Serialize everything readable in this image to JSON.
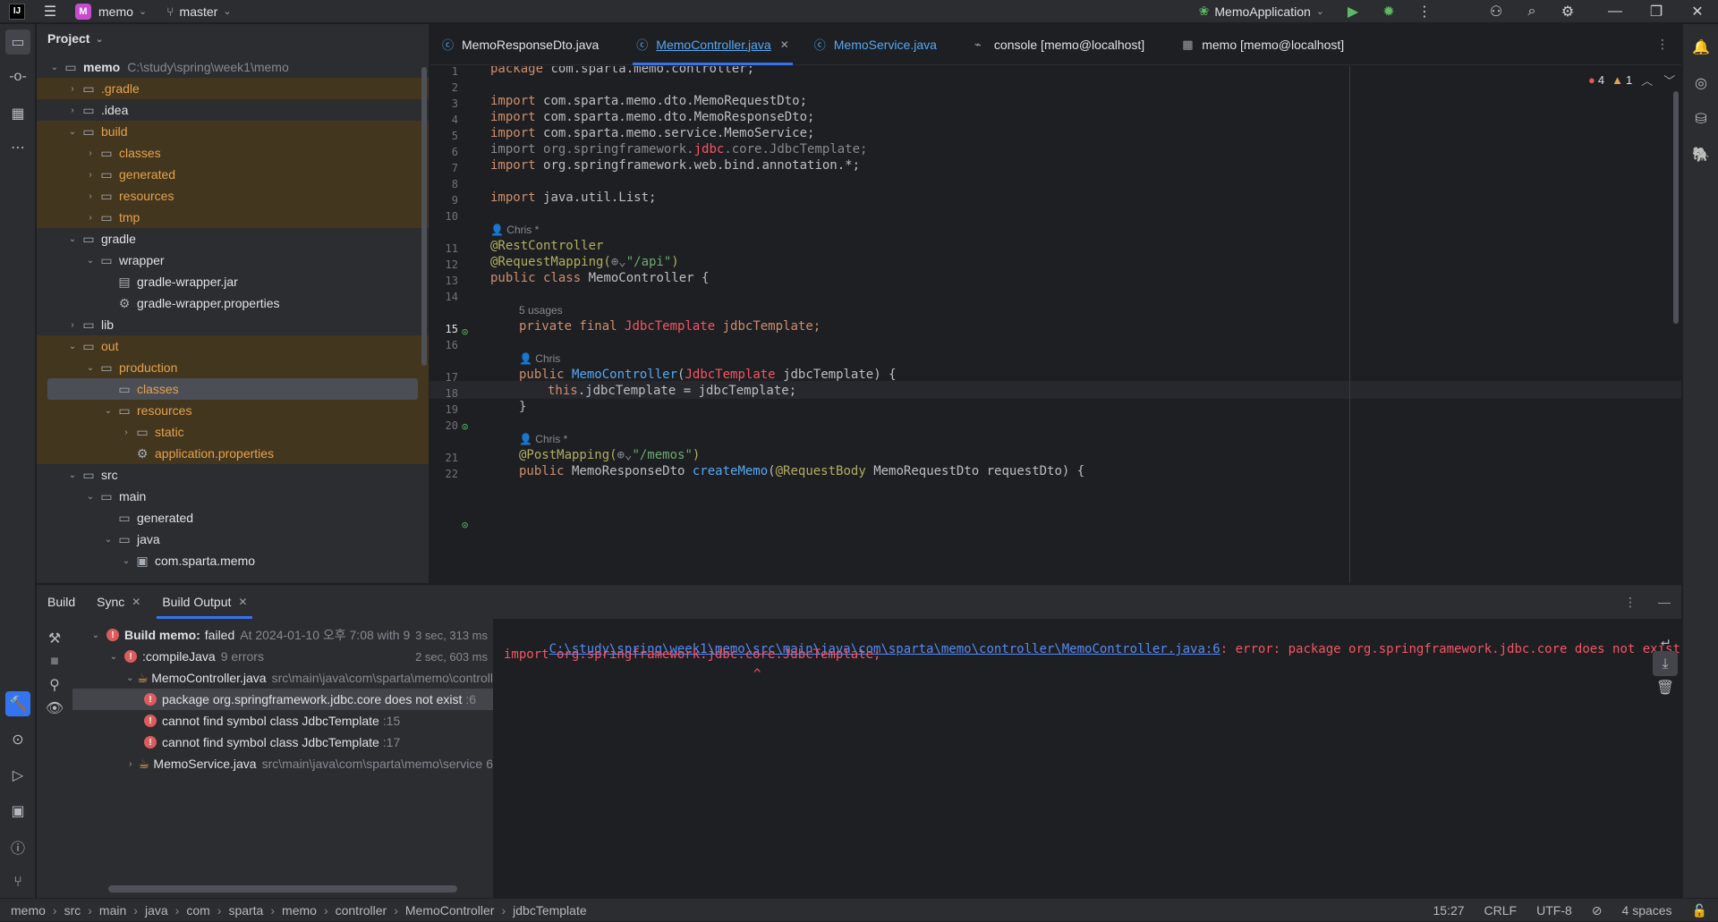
{
  "titlebar": {
    "logo": "IJ",
    "project_badge": "M",
    "project": "memo",
    "branch": "master",
    "run_config": "MemoApplication"
  },
  "project_panel": {
    "title": "Project",
    "root_label": "memo",
    "root_path": "C:\\study\\spring\\week1\\memo",
    "items": [
      {
        "label": ".gradle"
      },
      {
        "label": ".idea"
      },
      {
        "label": "build"
      },
      {
        "label": "classes"
      },
      {
        "label": "generated"
      },
      {
        "label": "resources"
      },
      {
        "label": "tmp"
      },
      {
        "label": "gradle"
      },
      {
        "label": "wrapper"
      },
      {
        "label": "gradle-wrapper.jar"
      },
      {
        "label": "gradle-wrapper.properties"
      },
      {
        "label": "lib"
      },
      {
        "label": "out"
      },
      {
        "label": "production"
      },
      {
        "label": "classes"
      },
      {
        "label": "resources"
      },
      {
        "label": "static"
      },
      {
        "label": "application.properties"
      },
      {
        "label": "src"
      },
      {
        "label": "main"
      },
      {
        "label": "generated"
      },
      {
        "label": "java"
      },
      {
        "label": "com.sparta.memo"
      }
    ]
  },
  "editor_tabs": [
    {
      "label": "MemoResponseDto.java"
    },
    {
      "label": "MemoController.java"
    },
    {
      "label": "MemoService.java"
    },
    {
      "label": "console [memo@localhost]"
    },
    {
      "label": "memo [memo@localhost]"
    }
  ],
  "editor": {
    "errors": "4",
    "warnings": "1",
    "line_numbers": [
      "1",
      "2",
      "3",
      "4",
      "5",
      "6",
      "7",
      "8",
      "9",
      "10",
      "11",
      "12",
      "13",
      "14",
      "15",
      "16",
      "17",
      "18",
      "19",
      "20",
      "21",
      "22"
    ],
    "hints": {
      "author1": "Chris *",
      "usages": "5 usages",
      "author2": "Chris",
      "author3": "Chris *"
    },
    "code": {
      "l1_kw": "package",
      "l1_rest": " com.sparta.memo.controller;",
      "l3": "com.sparta.memo.dto.MemoRequestDto;",
      "l4": "com.sparta.memo.dto.MemoResponseDto;",
      "l5": "com.sparta.memo.service.MemoService;",
      "l6_a": "org.springframework.",
      "l6_b": "jdbc",
      "l6_c": ".core.JdbcTemplate;",
      "l7": "org.springframework.web.bind.annotation.*;",
      "l9": "java.util.List;",
      "import_kw": "import",
      "l11": "@RestController",
      "l12_a": "@RequestMapping(",
      "l12_b": "\"/api\"",
      "l12_c": ")",
      "l13_kw": "public class",
      "l13_rest": " MemoController {",
      "l15_kw": "private final",
      "l15_type": "JdbcTemplate",
      "l15_name": "jdbcTemplate;",
      "l17_kw": "public",
      "l17_fn": "MemoController",
      "l17_a": "(",
      "l17_type": "JdbcTemplate",
      "l17_param": "jdbcTemplate",
      "l17_b": ") {",
      "l18_kw": "this",
      "l18_rest": ".jdbcTemplate = jdbcTemplate;",
      "l19": "}",
      "l21_a": "@PostMapping(",
      "l21_b": "\"/memos\"",
      "l21_c": ")",
      "l22_kw": "public",
      "l22_type": " MemoResponseDto ",
      "l22_fn": "createMemo",
      "l22_a": "(",
      "l22_an": "@RequestBody",
      "l22_b": " MemoRequestDto requestDto) {"
    }
  },
  "build_panel": {
    "tabs": [
      "Build",
      "Sync",
      "Build Output"
    ],
    "tree": {
      "root_label": "Build memo:",
      "root_status": "failed",
      "root_time": "At 2024-01-10 오후 7:08 with 9 e",
      "root_duration": "3 sec, 313 ms",
      "compile_label": ":compileJava",
      "compile_errors": "9 errors",
      "compile_duration": "2 sec, 603 ms",
      "file1": "MemoController.java",
      "file1_path": "src\\main\\java\\com\\sparta\\memo\\controll",
      "err1": "package org.springframework.jdbc.core does not exist",
      "err1_line": ":6",
      "err2": "cannot find symbol class JdbcTemplate",
      "err2_line": ":15",
      "err3": "cannot find symbol class JdbcTemplate",
      "err3_line": ":17",
      "file2": "MemoService.java",
      "file2_path": "src\\main\\java\\com\\sparta\\memo\\service",
      "file2_count": "6"
    },
    "output": {
      "link": "C:\\study\\spring\\week1\\memo\\src\\main\\java\\com\\sparta\\memo\\controller\\MemoController.java:6",
      "message": ": error: package org.springframework.jdbc.core does not exist",
      "line2": "import org.springframework.jdbc.core.JdbcTemplate;",
      "caret": "^"
    }
  },
  "statusbar": {
    "breadcrumbs": [
      "memo",
      "src",
      "main",
      "java",
      "com",
      "sparta",
      "memo",
      "controller",
      "MemoController",
      "jdbcTemplate"
    ],
    "position": "15:27",
    "line_sep": "CRLF",
    "encoding": "UTF-8",
    "indent": "4 spaces"
  },
  "colors": {
    "accent": "#3574f0",
    "error": "#db5c5c",
    "excluded_bg": "#43361f"
  }
}
